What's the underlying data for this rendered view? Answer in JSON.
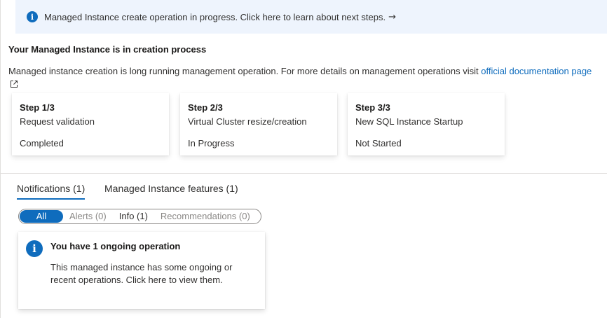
{
  "banner": {
    "icon": "info-icon",
    "text": "Managed Instance create operation in progress. Click here to learn about next steps.",
    "arrow": "→"
  },
  "section": {
    "title": "Your Managed Instance is in creation process",
    "description": "Managed instance creation is long running management operation. For more details on management operations visit",
    "link_text": "official documentation page",
    "link_icon": "external-link-icon"
  },
  "steps": [
    {
      "number": "Step 1/3",
      "name": "Request validation",
      "status": "Completed"
    },
    {
      "number": "Step 2/3",
      "name": "Virtual Cluster resize/creation",
      "status": "In Progress"
    },
    {
      "number": "Step 3/3",
      "name": "New SQL Instance Startup",
      "status": "Not Started"
    }
  ],
  "tabs": [
    {
      "label": "Notifications (1)",
      "active": true
    },
    {
      "label": "Managed Instance features (1)",
      "active": false
    }
  ],
  "filters": [
    {
      "label": "All",
      "selected": true
    },
    {
      "label": "Alerts (0)",
      "selected": false
    },
    {
      "label": "Info (1)",
      "selected": false
    },
    {
      "label": "Recommendations (0)",
      "selected": false
    }
  ],
  "notification": {
    "icon": "info-icon",
    "title": "You have 1 ongoing operation",
    "body": "This managed instance has some ongoing or recent operations. Click here to view them."
  },
  "colors": {
    "accent": "#0f6cbd",
    "banner_bg": "#eef4fd",
    "text": "#323130",
    "muted": "#8a8886"
  }
}
